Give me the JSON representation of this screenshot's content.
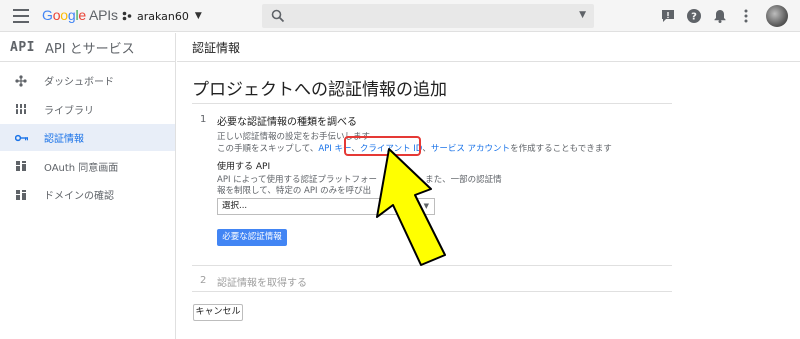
{
  "topbar": {
    "logo_google": "Google",
    "logo_apis": "APIs",
    "project_name": "arakan60",
    "icons": [
      "notifications-icon",
      "help-icon",
      "bell-icon",
      "more-icon",
      "avatar"
    ]
  },
  "sidebar": {
    "api_logo": "API",
    "title": "API とサービス",
    "items": [
      {
        "label": "ダッシュボード",
        "icon": "dashboard-icon"
      },
      {
        "label": "ライブラリ",
        "icon": "library-icon"
      },
      {
        "label": "認証情報",
        "icon": "key-icon",
        "active": true
      },
      {
        "label": "OAuth 同意画面",
        "icon": "consent-icon"
      },
      {
        "label": "ドメインの確認",
        "icon": "domain-icon"
      }
    ]
  },
  "main": {
    "header": "認証情報",
    "page_title": "プロジェクトへの認証情報の追加",
    "step1": {
      "num": "1",
      "title": "必要な認証情報の種類を調べる",
      "desc1": "正しい認証情報の設定をお手伝いします",
      "desc2_prefix": "この手順をスキップして、",
      "link_api_key": "API キー",
      "link_client_id": "クライアント ID",
      "link_service_account": "サービス アカウント",
      "desc2_suffix": "を作成することもできます",
      "api_label": "使用する API",
      "api_desc1": "API によって使用する認証プラットフォー",
      "api_desc1b": "す。また、一部の認証情",
      "api_desc2": "報を制限して、特定の API のみを呼び出",
      "api_desc2b": "す。",
      "select_value": "選択...",
      "button": "必要な認証情報"
    },
    "step2": {
      "num": "2",
      "title": "認証情報を取得する"
    },
    "cancel": "キャンセル"
  },
  "colors": {
    "accent": "#1a73e8",
    "button": "#4285f4",
    "highlight": "#e53935",
    "arrow": "#ffff00"
  }
}
